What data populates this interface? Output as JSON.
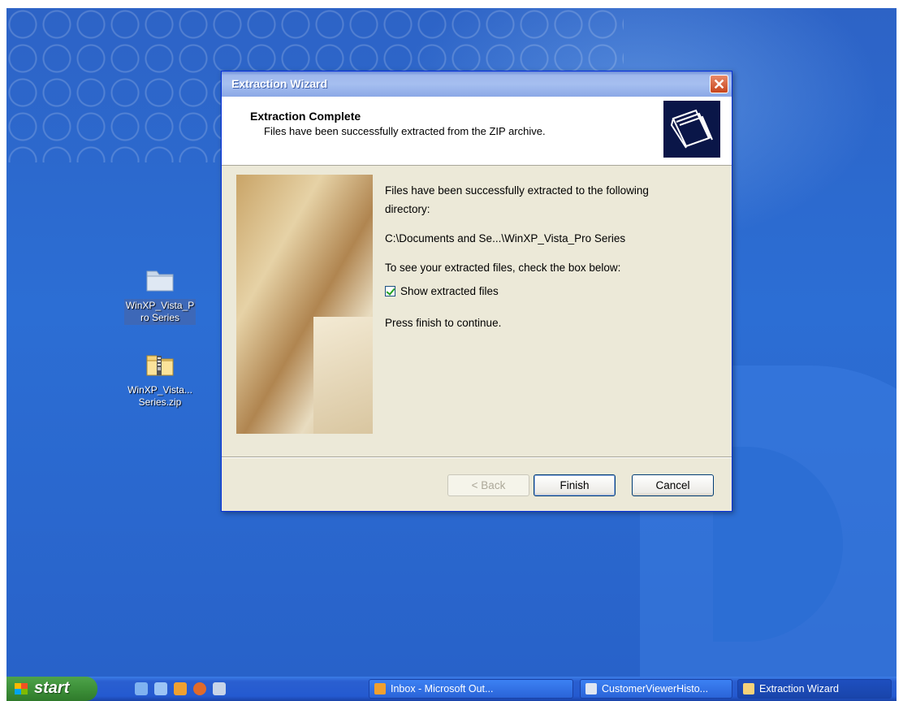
{
  "desktop": {
    "icons": [
      {
        "label": "WinXP_Vista_Pro Series",
        "label_line1": "WinXP_Vista_P",
        "label_line2": "ro Series",
        "icon": "folder-icon"
      },
      {
        "label_line1": "WinXP_Vista...",
        "label_line2": "Series.zip",
        "icon": "zip-folder-icon"
      }
    ]
  },
  "dialog": {
    "title": "Extraction Wizard",
    "close_label": "✕",
    "header": {
      "title": "Extraction Complete",
      "subtitle": "Files have been successfully extracted from the ZIP archive."
    },
    "body": {
      "line1": "Files have been successfully extracted to the following",
      "line2": "directory:",
      "path": "C:\\Documents and Se...\\WinXP_Vista_Pro Series",
      "see_files": "To see your extracted files, check the box below:",
      "checkbox_label": "Show extracted files",
      "checkbox_checked": true,
      "press_finish": "Press finish to continue."
    },
    "buttons": {
      "back": "< Back",
      "finish": "Finish",
      "cancel": "Cancel"
    }
  },
  "taskbar": {
    "start_label": "start",
    "quick_launch": [
      "ie-icon",
      "desktop-icon",
      "outlook-icon",
      "firefox-icon",
      "network-icon"
    ],
    "tasks": [
      {
        "label": "Inbox - Microsoft Out...",
        "icon": "outlook-icon"
      },
      {
        "label": "CustomerViewerHisto...",
        "icon": "window-icon"
      },
      {
        "label": "Extraction Wizard",
        "icon": "folder-icon",
        "active": true
      }
    ]
  },
  "colors": {
    "desktop_blue": "#2c6ed4",
    "titlebar": "#a6bff0",
    "dialog_bg": "#ece9d8",
    "start_green": "#3a8c36",
    "taskbar_blue": "#245ad0"
  }
}
